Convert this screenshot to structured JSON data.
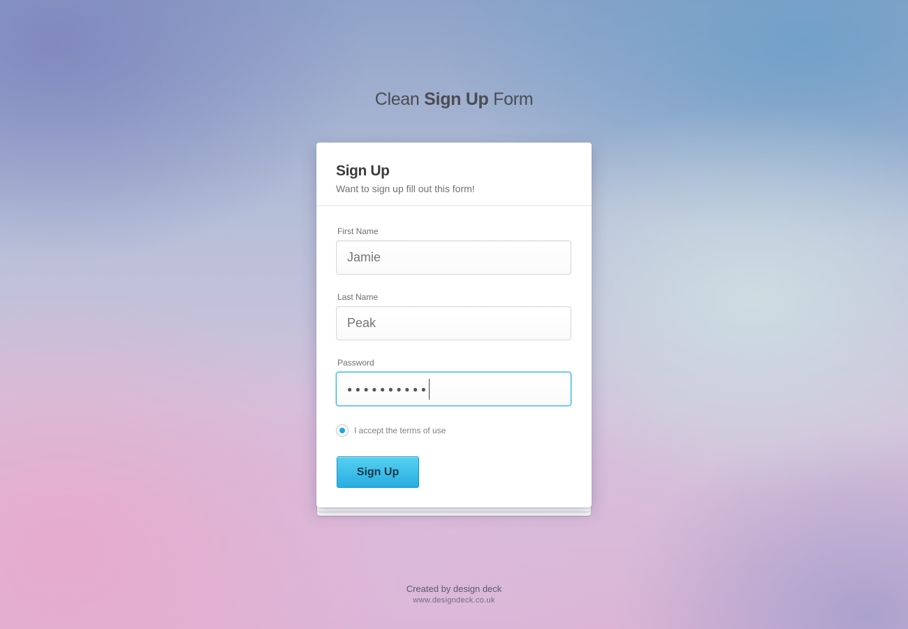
{
  "page": {
    "heading_pre": "Clean",
    "heading_bold": "Sign Up",
    "heading_post": "Form"
  },
  "form": {
    "title": "Sign Up",
    "subtitle": "Want to sign up fill out this form!",
    "first_name": {
      "label": "First Name",
      "placeholder": "Jamie"
    },
    "last_name": {
      "label": "Last Name",
      "placeholder": "Peak"
    },
    "password": {
      "label": "Password",
      "masked_value": "●●●●●●●●●●",
      "char_count": 10,
      "focused": true
    },
    "terms": {
      "label": "I accept the terms of use",
      "checked": true
    },
    "submit_label": "Sign Up"
  },
  "footer": {
    "credit": "Created by design deck",
    "url": "www.designdeck.co.uk"
  },
  "colors": {
    "accent": "#28ade0",
    "accent_light": "#56d0f2",
    "focus_border": "#2fb6e3",
    "text_dark": "#3c3c3c",
    "text_muted": "#707070"
  }
}
